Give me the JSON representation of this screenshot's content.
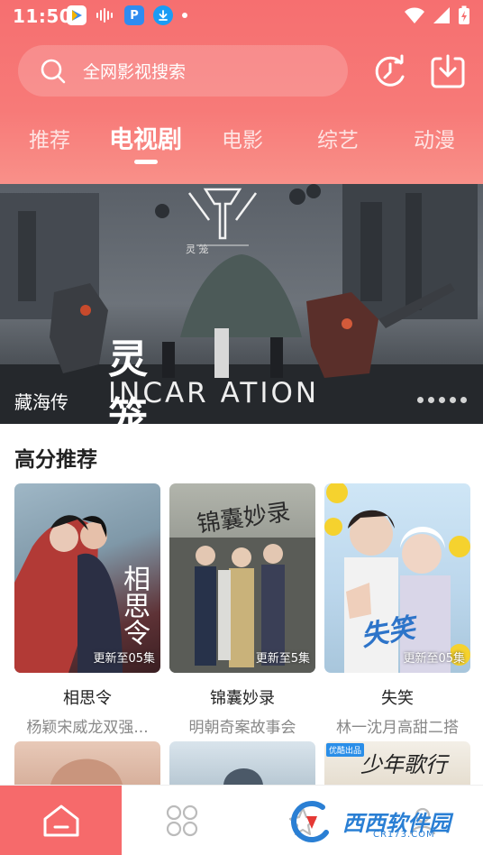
{
  "status_bar": {
    "time": "11:50",
    "left_icons": [
      "media-app-icon",
      "waveform-icon",
      "parking-app-icon",
      "download-app-icon",
      "dot-icon"
    ],
    "right_icons": [
      "wifi-icon",
      "signal-icon",
      "battery-charging-icon"
    ]
  },
  "search": {
    "placeholder": "全网影视搜索",
    "icon": "search-icon"
  },
  "header_buttons": {
    "history_icon": "history-icon",
    "download_icon": "download-icon"
  },
  "tabs": [
    {
      "label": "推荐",
      "active": false
    },
    {
      "label": "电视剧",
      "active": true
    },
    {
      "label": "电影",
      "active": false
    },
    {
      "label": "综艺",
      "active": false
    },
    {
      "label": "动漫",
      "active": false
    }
  ],
  "banner": {
    "caption": "藏海传",
    "title_cn": "灵笼",
    "title_en": "INCAR ATION",
    "logo_sub": "灵 笼",
    "dots": 5
  },
  "section": {
    "title": "高分推荐"
  },
  "cards": [
    {
      "title": "相思令",
      "subtitle": "杨颖宋威龙双强...",
      "update": "更新至05集",
      "poster_text": "相思令"
    },
    {
      "title": "锦囊妙录",
      "subtitle": "明朝奇案故事会",
      "update": "更新至5集",
      "poster_text": "锦囊妙录"
    },
    {
      "title": "失笑",
      "subtitle": "林一沈月高甜二搭",
      "update": "更新至05集",
      "poster_text": "失笑"
    }
  ],
  "row2": {
    "badge": "优酷出品",
    "poster_text": "少年歌行"
  },
  "bottom_nav": {
    "items": [
      "home-icon",
      "apps-grid-icon",
      "discover-icon",
      "profile-icon"
    ]
  },
  "watermark": {
    "main": "西西软件园",
    "sub": "CR173.COM"
  },
  "colors": {
    "accent": "#f66a6b",
    "header_top": "#f66f70",
    "header_bottom": "#f99089"
  }
}
